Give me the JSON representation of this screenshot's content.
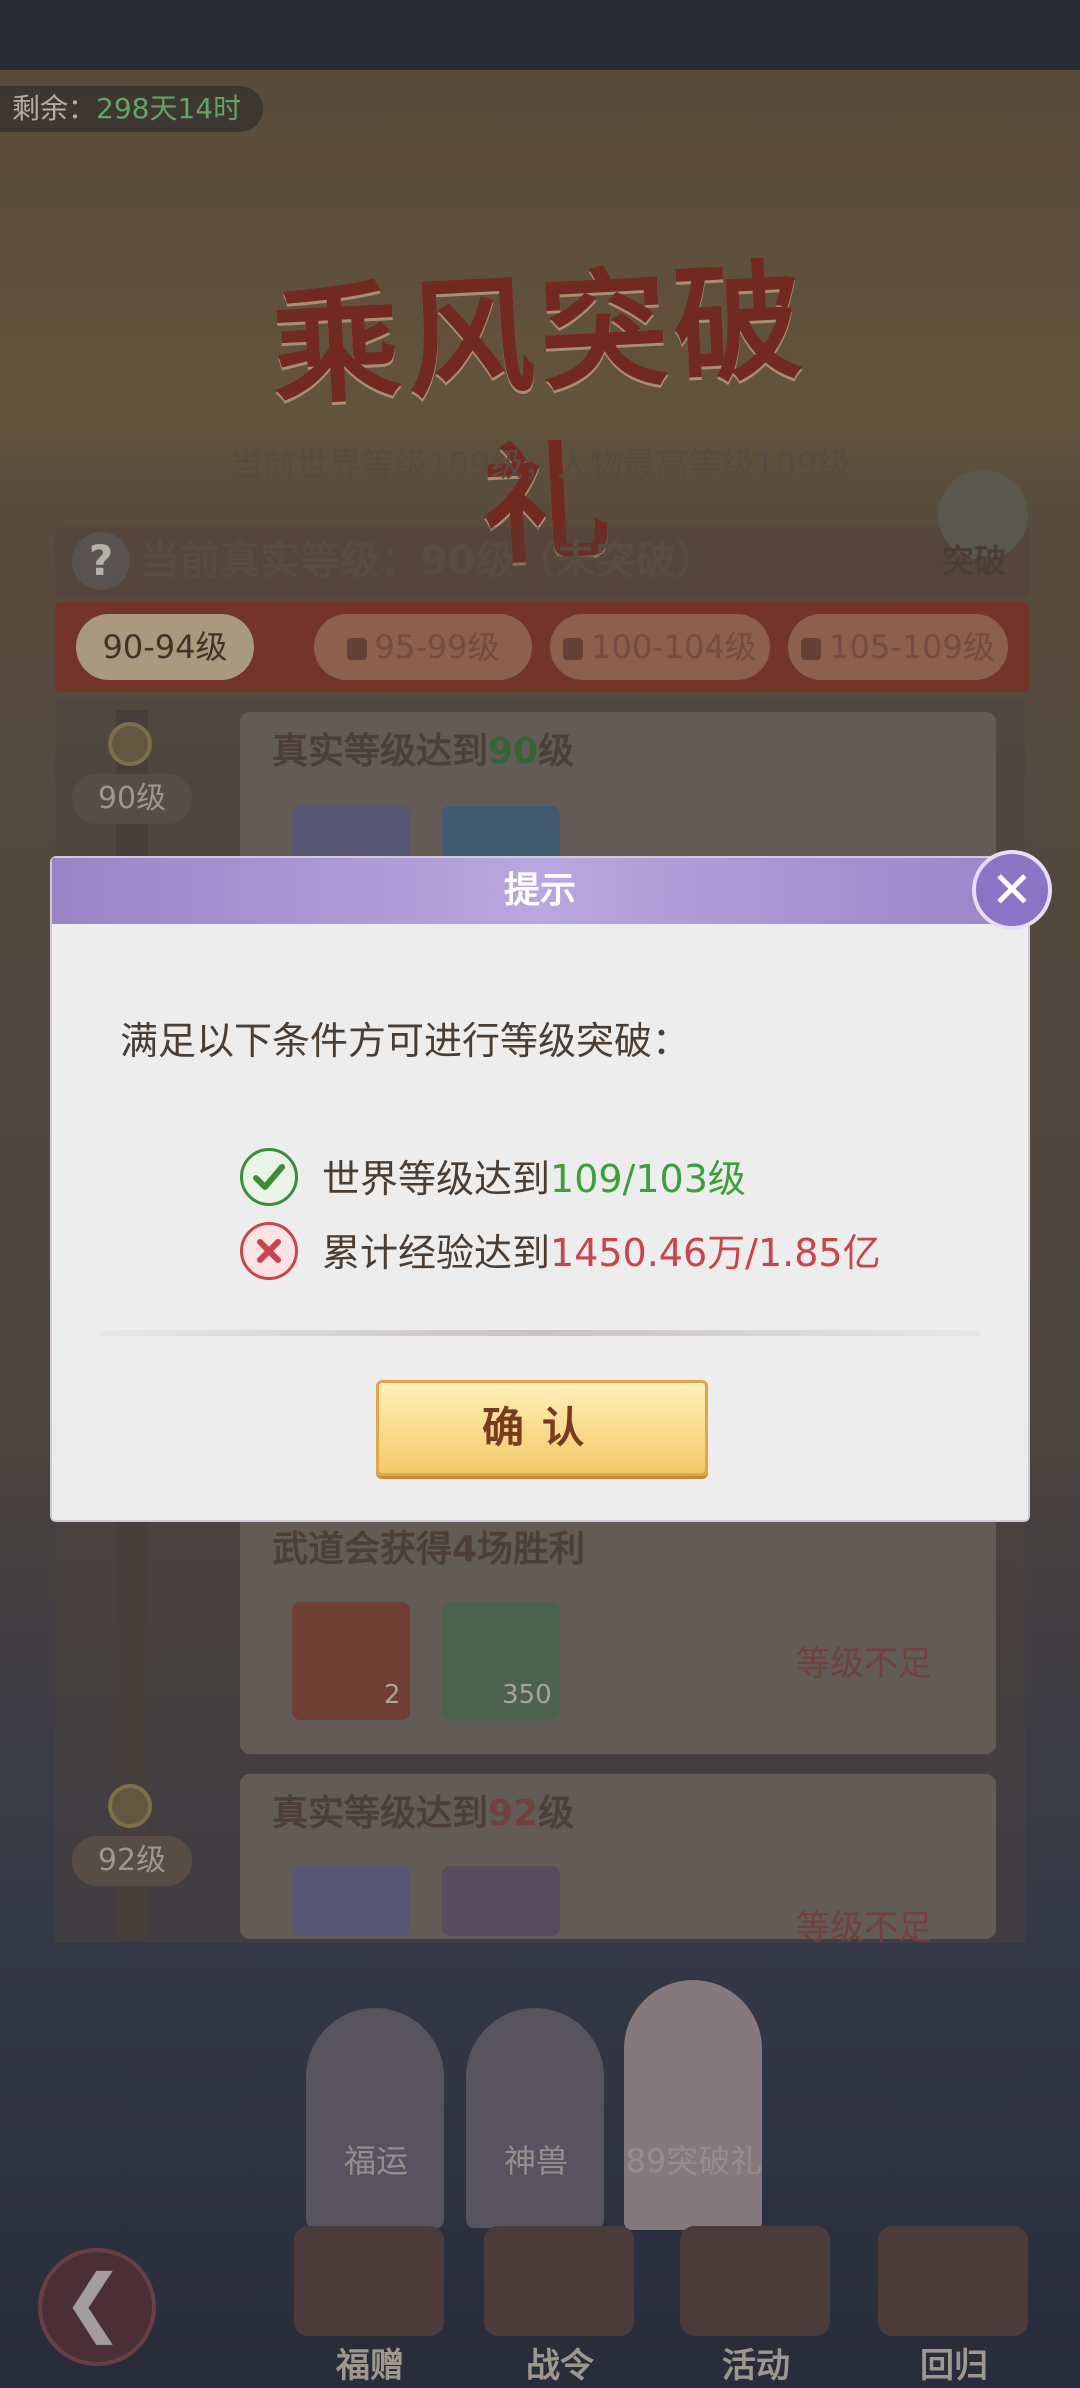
{
  "status": {
    "remaining_label": "剩余：",
    "remaining_value": "298天14时"
  },
  "banner": {
    "title": "乘风突破礼",
    "subtitle": "当前世界等级109级，人物最高等级109级"
  },
  "info": {
    "real_level_text": "当前真实等级：90级（未突破）",
    "break_label": "突破"
  },
  "tabs": [
    {
      "label": "90-94级",
      "active": true,
      "locked": false
    },
    {
      "label": "95-99级",
      "active": false,
      "locked": true
    },
    {
      "label": "100-104级",
      "active": false,
      "locked": true
    },
    {
      "label": "105-109级",
      "active": false,
      "locked": true
    }
  ],
  "tasks": {
    "lvl90_badge": "90级",
    "lvl92_badge": "92级",
    "task1_title_prefix": "真实等级达到",
    "task1_title_num": "90",
    "task1_title_suffix": "级",
    "task2_title": "武道会获得4场胜利",
    "task2_status": "等级不足",
    "task2_item1_count": "2",
    "task2_item2_count": "350",
    "task3_title_prefix": "真实等级达到",
    "task3_title_num": "92",
    "task3_title_suffix": "级",
    "task3_status": "等级不足"
  },
  "characters": [
    {
      "label": "福运"
    },
    {
      "label": "神兽"
    },
    {
      "label": "89突破礼"
    }
  ],
  "nav": [
    {
      "label": "福赠"
    },
    {
      "label": "战令"
    },
    {
      "label": "活动"
    },
    {
      "label": "回归"
    }
  ],
  "dialog": {
    "title": "提示",
    "message": "满足以下条件方可进行等级突破：",
    "cond1_text": "世界等级达到",
    "cond1_value": "109/103级",
    "cond1_met": true,
    "cond2_text": "累计经验达到",
    "cond2_value": "1450.46万/1.85亿",
    "cond2_met": false,
    "confirm_label": "确认"
  },
  "colors": {
    "dialog_header": "#9a84c8",
    "ok_green": "#3b9f3b",
    "bad_red": "#c8454d",
    "confirm_gold": "#f4c96a"
  }
}
